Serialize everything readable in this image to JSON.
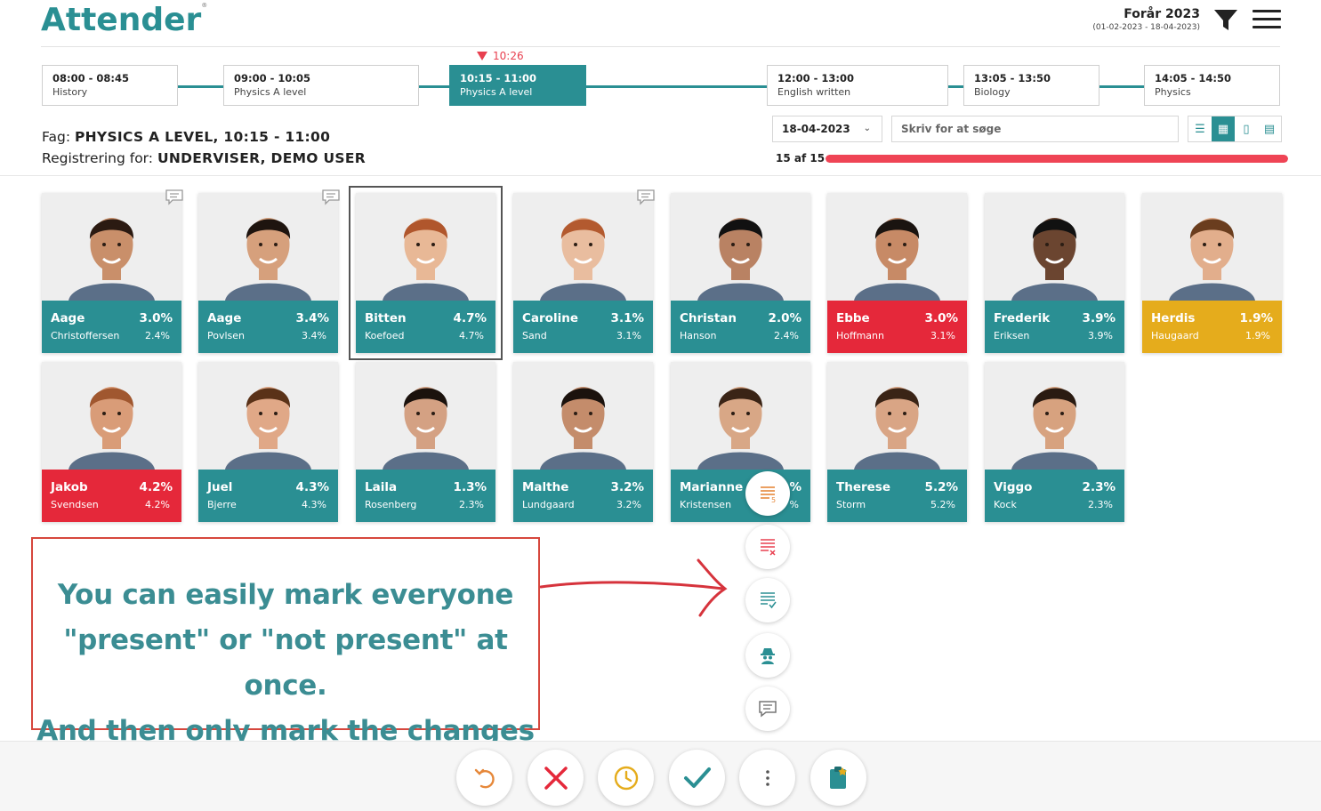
{
  "app": {
    "logo": "Attender",
    "registered_mark": "®"
  },
  "term": {
    "name": "Forår 2023",
    "range": "(01-02-2023 - 18-04-2023)"
  },
  "timeline": {
    "now": "10:26",
    "lessons": [
      {
        "time": "08:00 - 08:45",
        "subject": "History"
      },
      {
        "time": "09:00 - 10:05",
        "subject": "Physics A level"
      },
      {
        "time": "10:15 - 11:00",
        "subject": "Physics A level"
      },
      {
        "time": "12:00 - 13:00",
        "subject": "English written"
      },
      {
        "time": "13:05 - 13:50",
        "subject": "Biology"
      },
      {
        "time": "14:05 - 14:50",
        "subject": "Physics"
      }
    ]
  },
  "subject": {
    "fag_label": "Fag:",
    "fag_value": "PHYSICS A LEVEL, 10:15 - 11:00",
    "reg_label": "Registrering for:",
    "reg_value": "UNDERVISER, DEMO USER"
  },
  "controls": {
    "date": "18-04-2023",
    "search_placeholder": "Skriv for at søge",
    "progress_label": "15 af 15",
    "progress_fraction": 1.0
  },
  "students": [
    {
      "first": "Aage",
      "last": "Christoffersen",
      "p1": "3.0%",
      "p2": "2.4%",
      "status": "teal"
    },
    {
      "first": "Aage",
      "last": "Povlsen",
      "p1": "3.4%",
      "p2": "3.4%",
      "status": "teal"
    },
    {
      "first": "Bitten",
      "last": "Koefoed",
      "p1": "4.7%",
      "p2": "4.7%",
      "status": "teal"
    },
    {
      "first": "Caroline",
      "last": "Sand",
      "p1": "3.1%",
      "p2": "3.1%",
      "status": "teal"
    },
    {
      "first": "Christan",
      "last": "Hanson",
      "p1": "2.0%",
      "p2": "2.4%",
      "status": "teal"
    },
    {
      "first": "Ebbe",
      "last": "Hoffmann",
      "p1": "3.0%",
      "p2": "3.1%",
      "status": "red"
    },
    {
      "first": "Frederik",
      "last": "Eriksen",
      "p1": "3.9%",
      "p2": "3.9%",
      "status": "teal"
    },
    {
      "first": "Herdis",
      "last": "Haugaard",
      "p1": "1.9%",
      "p2": "1.9%",
      "status": "yellow"
    },
    {
      "first": "Jakob",
      "last": "Svendsen",
      "p1": "4.2%",
      "p2": "4.2%",
      "status": "red"
    },
    {
      "first": "Juel",
      "last": "Bjerre",
      "p1": "4.3%",
      "p2": "4.3%",
      "status": "teal"
    },
    {
      "first": "Laila",
      "last": "Rosenberg",
      "p1": "1.3%",
      "p2": "2.3%",
      "status": "teal"
    },
    {
      "first": "Malthe",
      "last": "Lundgaard",
      "p1": "3.2%",
      "p2": "3.2%",
      "status": "teal"
    },
    {
      "first": "Marianne",
      "last": "Kristensen",
      "p1": "%",
      "p2": "%",
      "status": "teal"
    },
    {
      "first": "Therese",
      "last": "Storm",
      "p1": "5.2%",
      "p2": "5.2%",
      "status": "teal"
    },
    {
      "first": "Viggo",
      "last": "Kock",
      "p1": "2.3%",
      "p2": "2.3%",
      "status": "teal"
    }
  ],
  "callout": {
    "line1": "You can easily mark everyone",
    "line2": "\"present\" or \"not present\" at once.",
    "line3": "And then only mark the changes"
  },
  "colors": {
    "teal": "#2a8f93",
    "red": "#e5283a",
    "yellow": "#e5ac1c",
    "accent_red": "#ef4455"
  },
  "icons": {
    "fab": [
      "list-order-icon",
      "list-clear-icon",
      "list-check-icon",
      "spy-icon",
      "comment-icon"
    ],
    "bottom": [
      "undo-icon",
      "absent-x-icon",
      "late-clock-icon",
      "present-check-icon",
      "more-dots-icon",
      "clipboard-icon"
    ]
  }
}
